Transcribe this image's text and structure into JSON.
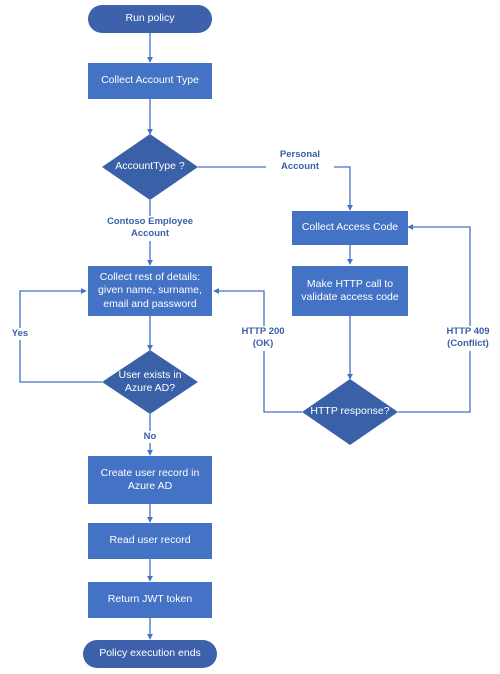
{
  "diagram": {
    "title": "Run policy flowchart",
    "colors": {
      "terminator_fill": "#3d62ab",
      "process_fill": "#4472c4",
      "decision_fill": "#3a61a8",
      "connector": "#4472c4",
      "label_text": "#3c5fa6",
      "node_text": "#ffffff",
      "background": "#ffffff"
    }
  },
  "nodes": [
    {
      "id": "run-policy",
      "type": "terminator",
      "label": "Run policy"
    },
    {
      "id": "collect-account-type",
      "type": "process",
      "label": "Collect Account Type"
    },
    {
      "id": "account-type",
      "type": "decision",
      "label": "AccountType ?"
    },
    {
      "id": "collect-access-code",
      "type": "process",
      "label": "Collect Access Code"
    },
    {
      "id": "make-http-call",
      "type": "process",
      "label": "Make HTTP call to\nvalidate access code"
    },
    {
      "id": "collect-rest-details",
      "type": "process",
      "label": "Collect rest of details:\ngiven name, surname,\nemail and password"
    },
    {
      "id": "user-exists",
      "type": "decision",
      "label": "User exists in\nAzure AD?"
    },
    {
      "id": "http-response",
      "type": "decision",
      "label": "HTTP response?"
    },
    {
      "id": "create-user-record",
      "type": "process",
      "label": "Create user record in\nAzure AD"
    },
    {
      "id": "read-user-record",
      "type": "process",
      "label": "Read user record"
    },
    {
      "id": "return-jwt-token",
      "type": "process",
      "label": "Return JWT token"
    },
    {
      "id": "policy-execution-ends",
      "type": "terminator",
      "label": "Policy execution ends"
    }
  ],
  "edge_labels": [
    {
      "id": "personal-account",
      "text": "Personal\nAccount"
    },
    {
      "id": "contoso-employee-account",
      "text": "Contoso Employee\nAccount"
    },
    {
      "id": "http-409-conflict",
      "text": "HTTP 409\n(Conflict)"
    },
    {
      "id": "http-200-ok",
      "text": "HTTP 200\n(OK)"
    },
    {
      "id": "yes",
      "text": "Yes"
    },
    {
      "id": "no",
      "text": "No"
    }
  ]
}
